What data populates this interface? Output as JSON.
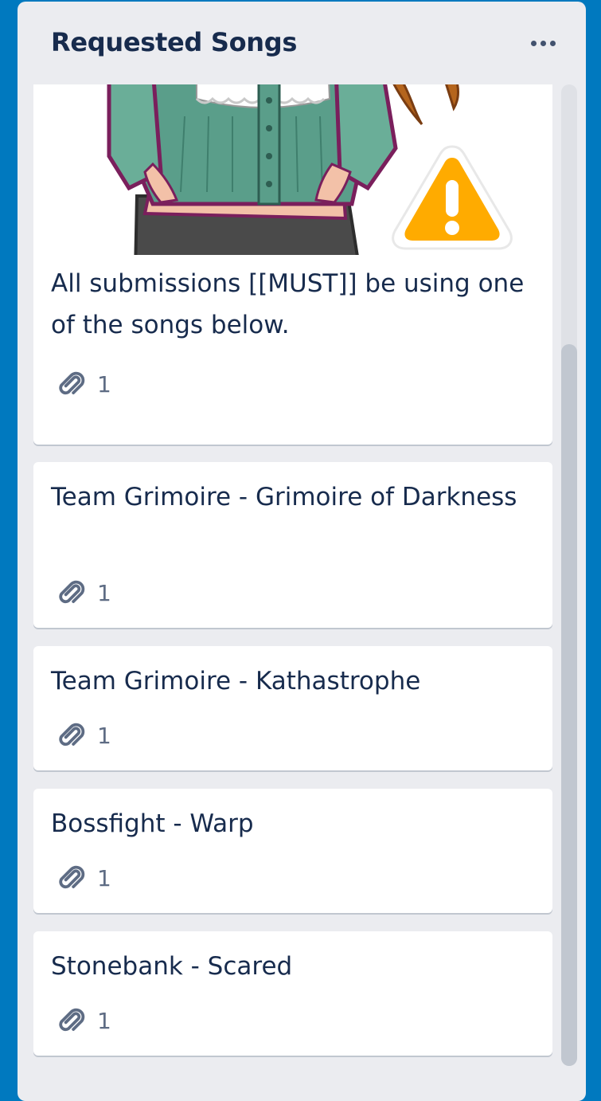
{
  "list": {
    "title": "Requested Songs",
    "menu_icon": "more-horizontal-icon"
  },
  "cards": [
    {
      "title": "All submissions [[MUST]] be using one of the songs below.",
      "attachments": "1",
      "cover_icons": [
        "anime-character-illustration",
        "warning-icon"
      ]
    },
    {
      "title": "Team Grimoire - Grimoire of Darkness",
      "attachments": "1"
    },
    {
      "title": "Team Grimoire - Kathastrophe",
      "attachments": "1"
    },
    {
      "title": "Bossfight - Warp",
      "attachments": "1"
    },
    {
      "title": "Stonebank - Scared",
      "attachments": "1"
    }
  ],
  "badge_icon": "paperclip-icon",
  "colors": {
    "board_background": "#0079bf",
    "list_background": "#ebecf0",
    "title_text": "#172b4d",
    "warning_orange": "#ffab00"
  }
}
